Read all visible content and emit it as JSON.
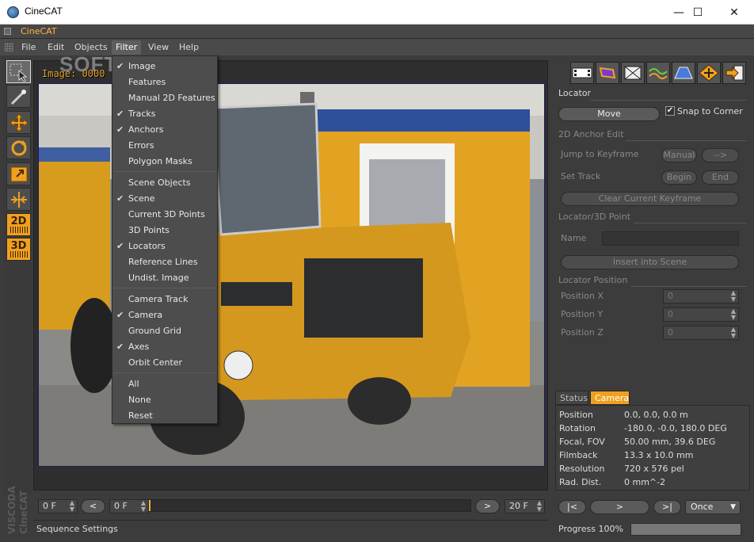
{
  "window": {
    "title": "CineCAT",
    "minimize": "—",
    "maximize": "☐",
    "close": "✕"
  },
  "app_title": "CineCAT",
  "menu": [
    "File",
    "Edit",
    "Objects",
    "Filter",
    "View",
    "Help"
  ],
  "menu_active": "Filter",
  "watermark": "SOFTPEDIA",
  "image_label": "Image: 0000",
  "filter_menu": [
    {
      "label": "Image",
      "checked": true
    },
    {
      "label": "Features",
      "checked": false
    },
    {
      "label": "Manual 2D Features",
      "checked": false
    },
    {
      "label": "Tracks",
      "checked": true
    },
    {
      "label": "Anchors",
      "checked": true
    },
    {
      "label": "Errors",
      "checked": false
    },
    {
      "label": "Polygon Masks",
      "checked": false
    },
    {
      "label": "Scene Objects",
      "checked": false
    },
    {
      "label": "Scene",
      "checked": true
    },
    {
      "label": "Current 3D Points",
      "checked": false
    },
    {
      "label": "3D Points",
      "checked": false
    },
    {
      "label": "Locators",
      "checked": true
    },
    {
      "label": "Reference Lines",
      "checked": false
    },
    {
      "label": "Undist. Image",
      "checked": false
    },
    {
      "label": "Camera Track",
      "checked": false
    },
    {
      "label": "Camera",
      "checked": true
    },
    {
      "label": "Ground Grid",
      "checked": false
    },
    {
      "label": "Axes",
      "checked": true
    },
    {
      "label": "Orbit Center",
      "checked": false
    },
    {
      "label": "All",
      "checked": false
    },
    {
      "label": "None",
      "checked": false
    },
    {
      "label": "Reset",
      "checked": false
    }
  ],
  "check_glyph": "✔",
  "tools": {
    "mode_2d": "2D",
    "mode_3d": "3D"
  },
  "vendor": {
    "line1": "VISCODA",
    "line2": "CineCAT"
  },
  "timeline": {
    "start_frame": "0 F",
    "prev": "<",
    "current_frame": "0 F",
    "next": ">",
    "end_frame": "20 F"
  },
  "status_text": "Sequence Settings",
  "locator": {
    "title": "Locator",
    "move": "Move",
    "snap_to_corner": "Snap to Corner",
    "snap_checked": true,
    "anchor_edit_title": "2D Anchor Edit",
    "jump_to_keyframe": "Jump to Keyframe",
    "manual": "Manual",
    "arrow": "-->",
    "set_track": "Set Track",
    "begin": "Begin",
    "end": "End",
    "clear_keyframe": "Clear Current Keyframe",
    "point_title": "Locator/3D Point",
    "name_label": "Name",
    "insert": "Insert into Scene",
    "position_title": "Locator Position",
    "pos_x_label": "Position X",
    "pos_y_label": "Position Y",
    "pos_z_label": "Position Z",
    "pos_x": "0",
    "pos_y": "0",
    "pos_z": "0"
  },
  "tabs": [
    "Status",
    "Camera"
  ],
  "active_tab": "Camera",
  "camera_info": [
    {
      "key": "Position",
      "value": "0.0, 0.0, 0.0 m"
    },
    {
      "key": "Rotation",
      "value": "-180.0, -0.0, 180.0 DEG"
    },
    {
      "key": "Focal, FOV",
      "value": "50.00 mm, 39.6 DEG"
    },
    {
      "key": "Filmback",
      "value": "13.3 x 10.0 mm"
    },
    {
      "key": "Resolution",
      "value": "720 x 576 pel"
    },
    {
      "key": "Rad. Dist.",
      "value": "0 mm^-2"
    }
  ],
  "playback": {
    "first": "|<",
    "play": ">",
    "last": ">|",
    "mode": "Once"
  },
  "progress": {
    "label": "Progress",
    "value": "100%",
    "fraction": 1.0
  },
  "colors": {
    "accent": "#ffb640",
    "panel": "#3c3c3c"
  }
}
